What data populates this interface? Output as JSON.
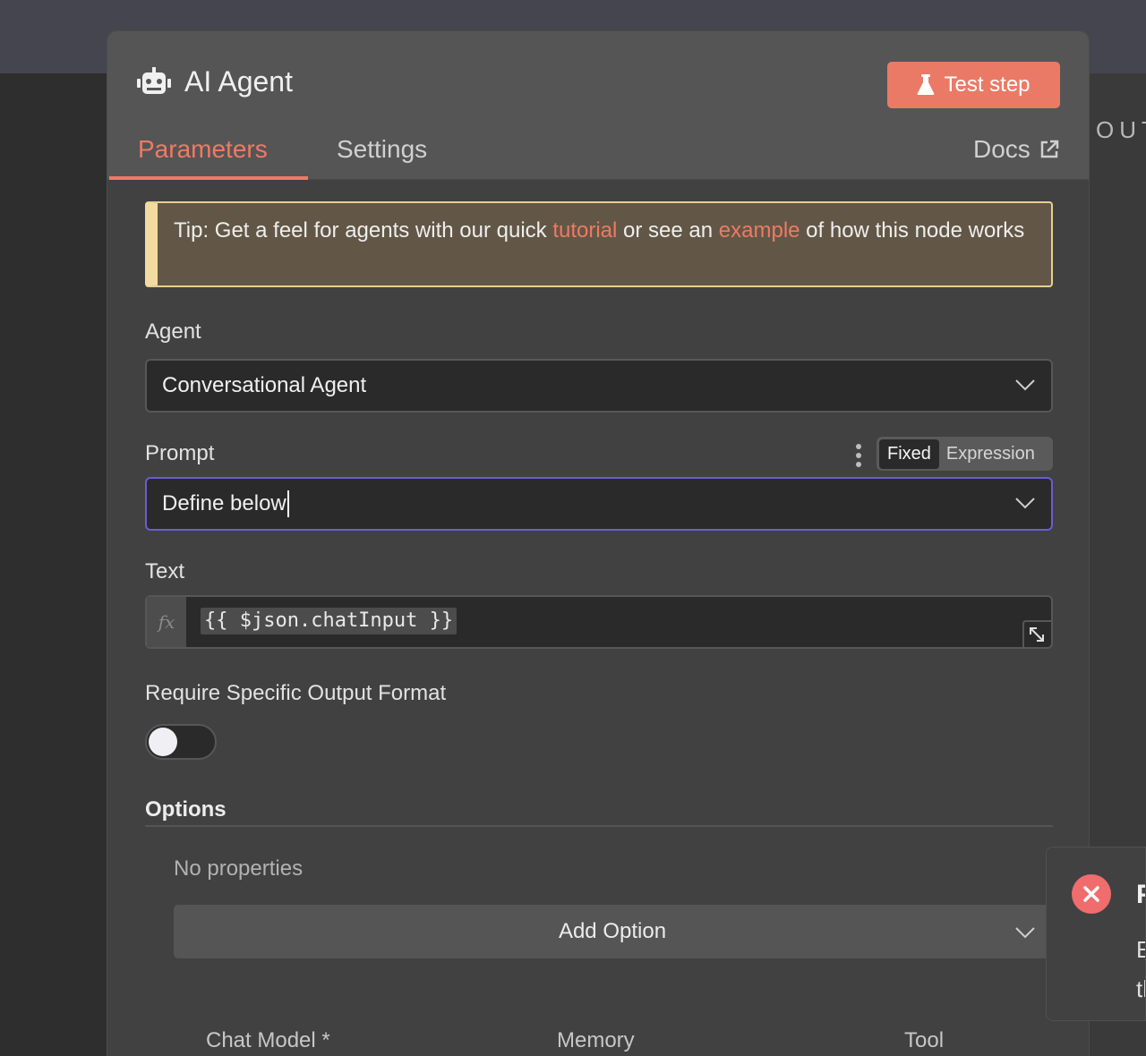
{
  "background_panel": {
    "output_label": "OUTPUT"
  },
  "node": {
    "title": "AI Agent",
    "icon": "robot-icon",
    "test_button_label": "Test step"
  },
  "tabs": [
    {
      "label": "Parameters",
      "active": true
    },
    {
      "label": "Settings",
      "active": false
    }
  ],
  "docs_label": "Docs",
  "tip": {
    "prefix": "Tip: Get a feel for agents with our quick ",
    "link1": "tutorial",
    "middle": " or see an ",
    "link2": "example",
    "suffix": " of how this node works"
  },
  "fields": {
    "agent": {
      "label": "Agent",
      "value": "Conversational Agent"
    },
    "prompt": {
      "label": "Prompt",
      "value": "Define below",
      "mode_fixed": "Fixed",
      "mode_expression": "Expression"
    },
    "text": {
      "label": "Text",
      "fx": "fx",
      "value": "{{ $json.chatInput }}"
    },
    "output_format": {
      "label": "Require Specific Output Format",
      "enabled": false
    }
  },
  "options": {
    "title": "Options",
    "empty_text": "No properties",
    "add_button_label": "Add Option"
  },
  "connections": [
    "Chat Model *",
    "Memory",
    "Tool"
  ],
  "toast": {
    "title": "Problem running workflow",
    "message": "Error in sub-node. Check the node parameters."
  },
  "colors": {
    "accent": "#ef7a63",
    "focus_border": "#6b5dd3",
    "tip_border": "#f2dba0",
    "error": "#f06d6d"
  }
}
